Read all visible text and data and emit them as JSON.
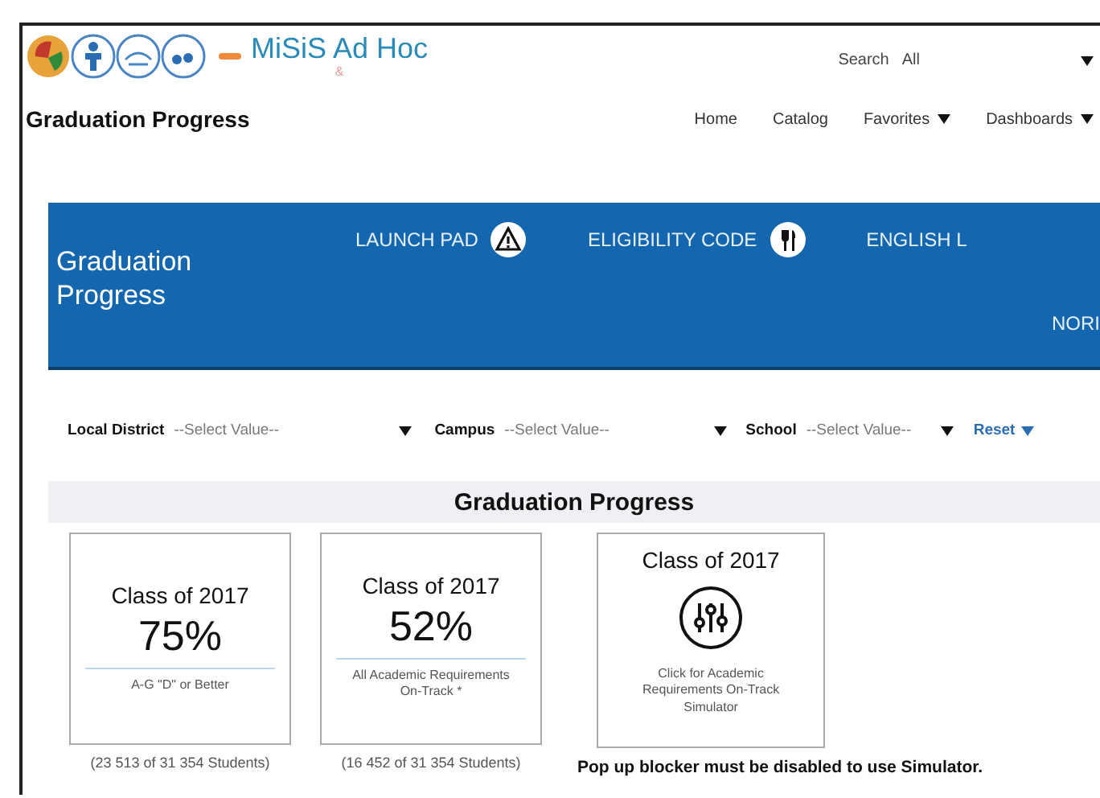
{
  "header": {
    "logo_text": "MiSiS Ad Hoc",
    "logo_sub": "&",
    "search": {
      "label": "Search",
      "value": "All"
    }
  },
  "page_title": "Graduation Progress",
  "nav": [
    {
      "label": "Home",
      "dropdown": false
    },
    {
      "label": "Catalog",
      "dropdown": false
    },
    {
      "label": "Favorites",
      "dropdown": true
    },
    {
      "label": "Dashboards",
      "dropdown": true
    }
  ],
  "banner": {
    "title": "Graduation Progress",
    "links": [
      "LAUNCH PAD",
      "ELIGIBILITY CODE",
      "ENGLISH L"
    ],
    "second_row": "NORI"
  },
  "filters": [
    {
      "label": "Local District",
      "placeholder": "--Select Value--"
    },
    {
      "label": "Campus",
      "placeholder": "--Select Value--"
    },
    {
      "label": "School",
      "placeholder": "--Select Value--"
    }
  ],
  "reset": "Reset",
  "section_title": "Graduation Progress",
  "cards": [
    {
      "kind": "stat",
      "title": "Class of 2017",
      "value": "75%",
      "caption": "A-G \"D\" or Better",
      "count": "(23 513 of 31 354 Students)"
    },
    {
      "kind": "stat",
      "title": "Class of 2017",
      "value": "52%",
      "caption": "All Academic Requirements On-Track *",
      "count": "(16 452 of 31 354 Students)"
    },
    {
      "kind": "link",
      "title": "Class of 2017",
      "caption": "Click for Academic Requirements On-Track Simulator",
      "note": "Pop up blocker must be disabled to use Simulator."
    }
  ]
}
